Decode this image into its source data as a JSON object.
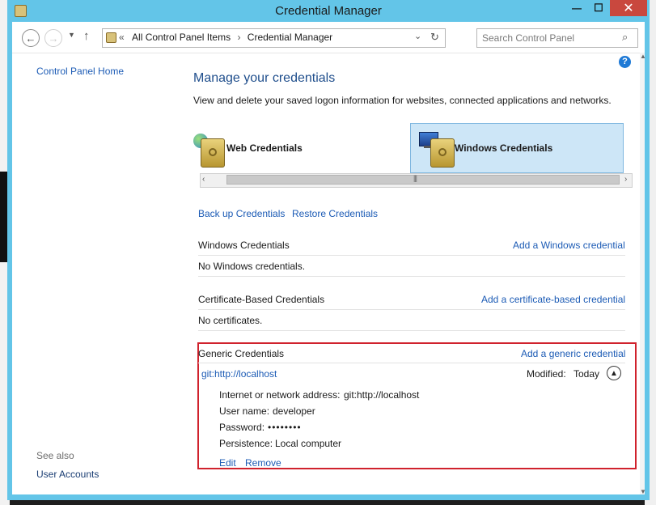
{
  "window": {
    "title": "Credential Manager"
  },
  "captions": {
    "minimize": "—",
    "maximize": "☐",
    "close": "✕"
  },
  "address": {
    "crumb_prefix": "«",
    "crumbs": [
      "All Control Panel Items",
      "Credential Manager"
    ],
    "separator": "›",
    "search_placeholder": "Search Control Panel"
  },
  "sidebar": {
    "home_link": "Control Panel Home",
    "see_also_label": "See also",
    "see_also_link": "User Accounts"
  },
  "main": {
    "heading": "Manage your credentials",
    "description": "View and delete your saved logon information for websites, connected applications and networks.",
    "tabs": [
      {
        "label": "Web Credentials",
        "selected": false
      },
      {
        "label": "Windows Credentials",
        "selected": true
      }
    ],
    "backup_link": "Back up Credentials",
    "restore_link": "Restore Credentials",
    "sections": {
      "windows": {
        "title": "Windows Credentials",
        "add_link": "Add a Windows credential",
        "empty": "No Windows credentials."
      },
      "certificate": {
        "title": "Certificate-Based Credentials",
        "add_link": "Add a certificate-based credential",
        "empty": "No certificates."
      },
      "generic": {
        "title": "Generic Credentials",
        "add_link": "Add a generic credential",
        "entry": {
          "name": "git:http://localhost",
          "modified_label": "Modified:",
          "modified_value": "Today",
          "address_label": "Internet or network address:",
          "address_value": "git:http://localhost",
          "username_label": "User name:",
          "username_value": "developer",
          "password_label": "Password:",
          "password_value": "••••••••",
          "persistence_label": "Persistence:",
          "persistence_value": "Local computer",
          "edit_link": "Edit",
          "remove_link": "Remove"
        }
      }
    }
  },
  "colors": {
    "window_frame": "#63c5e8",
    "link": "#1c5bb5",
    "heading": "#1f4e8c",
    "selected_tab": "#cde6f7",
    "highlight_border": "#d0222d",
    "close_button": "#c9483e"
  }
}
